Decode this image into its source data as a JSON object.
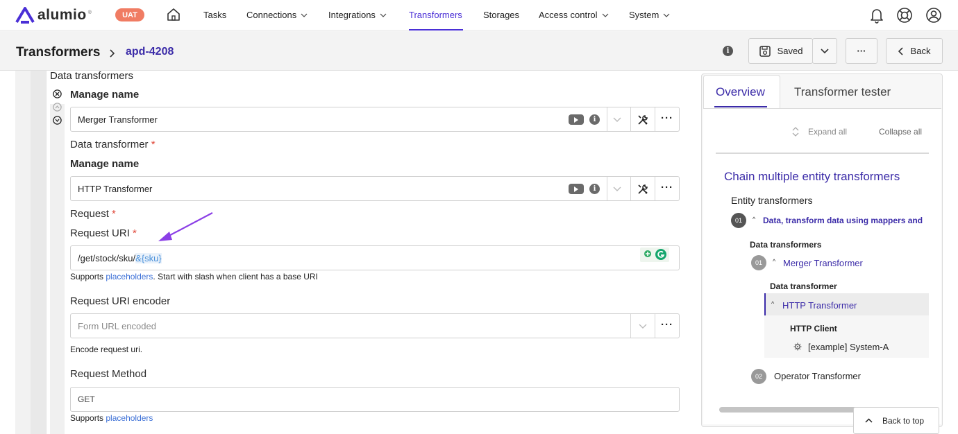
{
  "brand": {
    "name": "alumio",
    "env_badge": "UAT"
  },
  "nav": {
    "items": [
      {
        "label": "Tasks"
      },
      {
        "label": "Connections"
      },
      {
        "label": "Integrations"
      },
      {
        "label": "Transformers"
      },
      {
        "label": "Storages"
      },
      {
        "label": "Access control"
      },
      {
        "label": "System"
      }
    ],
    "active": "Transformers"
  },
  "header": {
    "title": "Transformers",
    "breadcrumb": "apd-4208",
    "saved_label": "Saved",
    "more_label": "···",
    "back_label": "Back"
  },
  "form": {
    "section_title": "Data transformers",
    "outer_manage_name_label": "Manage name",
    "outer_value": "Merger Transformer",
    "data_transformer_label": "Data transformer",
    "inner_manage_name_label": "Manage name",
    "inner_value": "HTTP Transformer",
    "request_label": "Request",
    "request_uri_label": "Request URI",
    "request_uri_prefix": "/get/stock/sku/",
    "request_uri_token": "&{sku}",
    "uri_help_prefix": "Supports ",
    "uri_help_link": "placeholders",
    "uri_help_suffix": ". Start with slash when client has a base URI",
    "encoder_label": "Request URI encoder",
    "encoder_value": "Form URL encoded",
    "encoder_help": "Encode request uri.",
    "method_label": "Request Method",
    "method_value": "GET",
    "method_help_prefix": "Supports ",
    "method_help_link": "placeholders",
    "required_mark": "*"
  },
  "overview": {
    "tabs": [
      {
        "label": "Overview"
      },
      {
        "label": "Transformer tester"
      }
    ],
    "expand_all": "Expand all",
    "collapse_all": "Collapse all",
    "heading": "Chain multiple entity transformers",
    "entity_label": "Entity transformers",
    "step1_num": "01",
    "step1_label": "Data, transform data using mappers and",
    "data_transformers_label": "Data transformers",
    "sub1_num": "01",
    "sub1_label": "Merger Transformer",
    "data_transformer_label": "Data transformer",
    "http_label": "HTTP Transformer",
    "http_client_label": "HTTP Client",
    "client_value": "[example] System-A",
    "step2_num": "02",
    "step2_label": "Operator Transformer",
    "back_to_top": "Back to top"
  },
  "colors": {
    "accent": "#4a2fd6",
    "badge": "#f07c63",
    "required": "#e0493b",
    "link": "#3b6fd6",
    "annotation_arrow": "#8b3fe6"
  }
}
